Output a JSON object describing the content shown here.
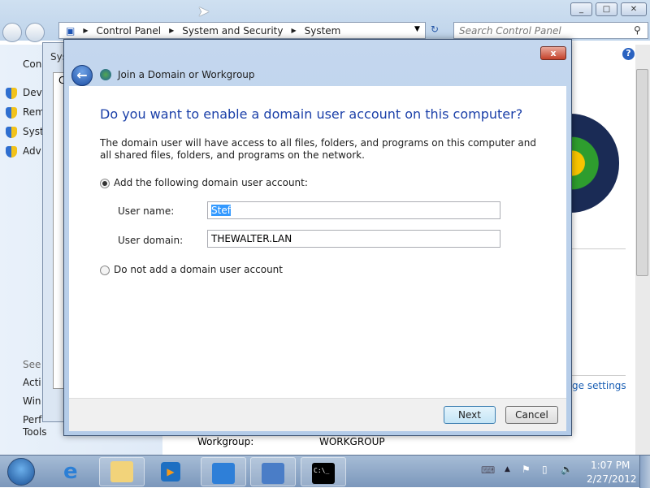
{
  "explorer": {
    "breadcrumb": [
      "Control Panel",
      "System and Security",
      "System"
    ],
    "search_placeholder": "Search Control Panel",
    "left_pane": {
      "header": "Con",
      "items": [
        "Dev",
        "Rem",
        "Syst",
        "Adv"
      ],
      "see_also": "See",
      "see_items": [
        "Acti",
        "Win",
        "Perf",
        "Tools"
      ]
    },
    "behind_dialog": {
      "title": "Sys",
      "text": "C"
    },
    "change_settings_link": "ge settings",
    "workgroup_label": "Workgroup:",
    "workgroup_value": "WORKGROUP",
    "help": "?"
  },
  "dialog": {
    "title": "Join a Domain or Workgroup",
    "heading": "Do you want to enable a domain user account on this computer?",
    "description": "The domain user will have access to all files, folders, and programs on this computer and all shared files, folders, and programs on the network.",
    "option_add": "Add the following domain user account:",
    "user_name_label": "User name:",
    "user_name_value": "Stef",
    "user_domain_label": "User domain:",
    "user_domain_value": "THEWALTER.LAN",
    "option_none": "Do not add a domain user account",
    "selected_option": "add",
    "next": "Next",
    "cancel": "Cancel",
    "close": "x"
  },
  "taskbar": {
    "time": "1:07 PM",
    "date": "2/27/2012",
    "console_text": "C:\\_"
  }
}
